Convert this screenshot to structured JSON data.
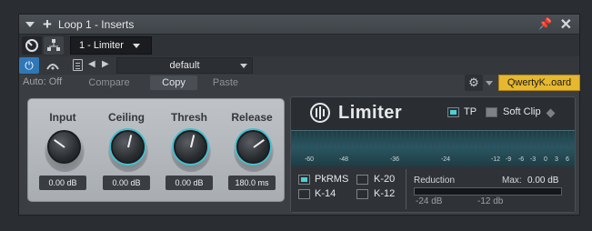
{
  "window": {
    "title": "Loop 1 - Inserts"
  },
  "header": {
    "insert_slot": "1 - Limiter",
    "auto_label": "Auto: Off",
    "preset": "default",
    "compare_label": "Compare",
    "copy_label": "Copy",
    "paste_label": "Paste",
    "keyboard_label": "QwertyK..oard"
  },
  "knobs": [
    {
      "label": "Input",
      "value": "0.00 dB",
      "level": 0.3
    },
    {
      "label": "Ceiling",
      "value": "0.00 dB",
      "level": 0.55
    },
    {
      "label": "Thresh",
      "value": "0.00 dB",
      "level": 0.55
    },
    {
      "label": "Release",
      "value": "180.0 ms",
      "level": 0.7
    }
  ],
  "limiter": {
    "brand": "Limiter",
    "tp_label": "TP",
    "softclip_label": "Soft Clip",
    "meter_ticks": [
      "-60",
      "-48",
      "-36",
      "-24",
      "-12",
      "-9",
      "-6",
      "-3",
      "0",
      "3",
      "6"
    ],
    "modes": [
      {
        "label": "PkRMS",
        "on": true
      },
      {
        "label": "K-20",
        "on": false
      },
      {
        "label": "K-14",
        "on": false
      },
      {
        "label": "K-12",
        "on": false
      }
    ],
    "reduction_label": "Reduction",
    "max_label": "Max:",
    "max_value": "0.00 dB",
    "reduction_ticks": [
      "-24 dB",
      "-12 db"
    ]
  },
  "colors": {
    "accent": "#2f78b8",
    "knob_ring": "#44c0d0",
    "keyboard_bg": "#e6b82e"
  }
}
